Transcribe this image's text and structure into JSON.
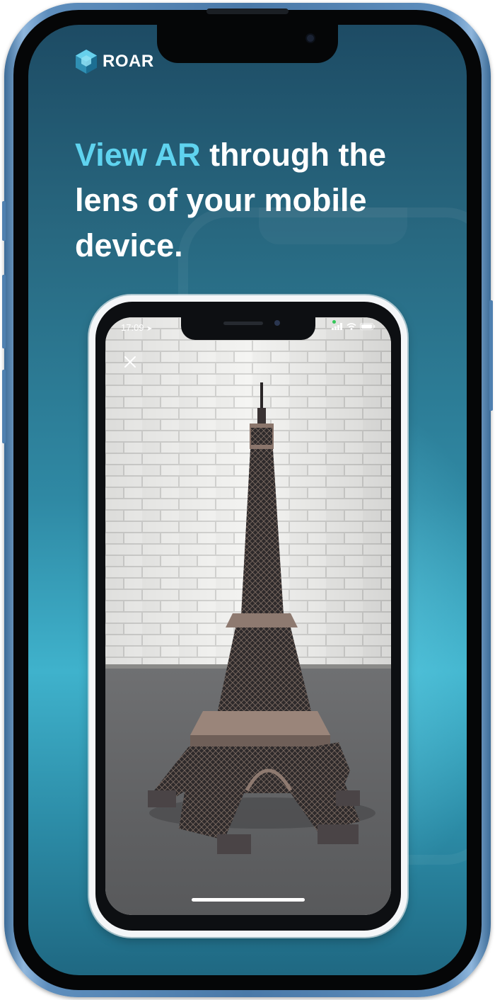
{
  "brand": {
    "name": "ROAR",
    "logo_icon": "hexagon-cube-icon",
    "accent_color": "#5fd3ef"
  },
  "headline": {
    "accent": "View AR",
    "rest": " through the lens of your mobile device."
  },
  "ar_preview": {
    "status_bar": {
      "time": "17:09",
      "location_icon": "location-arrow-icon",
      "signal_icon": "cellular-signal-icon",
      "wifi_icon": "wifi-icon",
      "battery_icon": "battery-icon"
    },
    "close_icon": "close-icon",
    "model": "eiffel-tower-model"
  },
  "colors": {
    "screen_top": "#1d4b64",
    "screen_mid": "#3fb2cc",
    "frame": "#4a79a8"
  }
}
